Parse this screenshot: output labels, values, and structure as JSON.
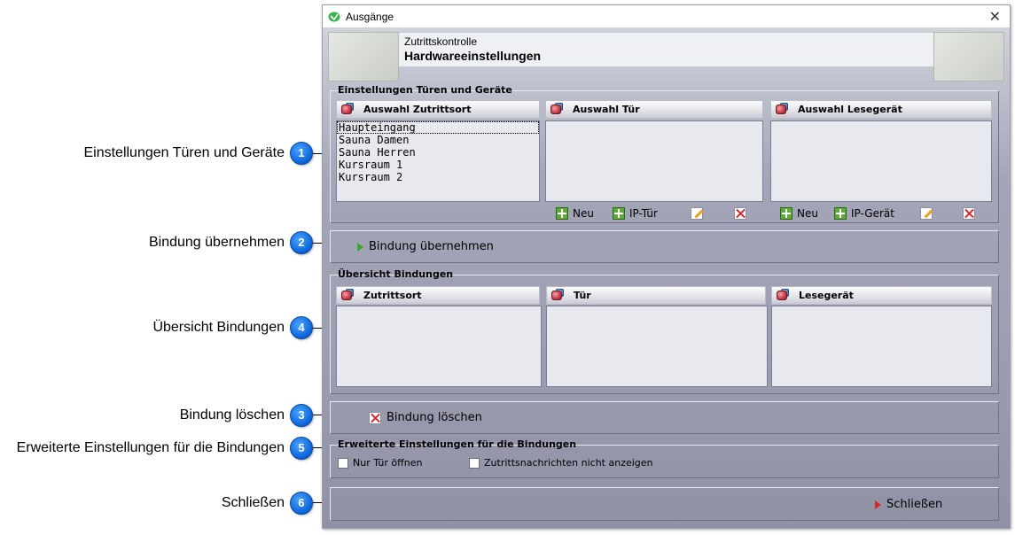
{
  "annotations": [
    {
      "num": "1",
      "label": "Einstellungen Türen und Geräte"
    },
    {
      "num": "2",
      "label": "Bindung übernehmen"
    },
    {
      "num": "4",
      "label": "Übersicht Bindungen"
    },
    {
      "num": "3",
      "label": "Bindung löschen"
    },
    {
      "num": "5",
      "label": "Erweiterte Einstellungen für die Bindungen"
    },
    {
      "num": "6",
      "label": "Schließen"
    }
  ],
  "window": {
    "title": "Ausgänge",
    "close_glyph": "✕",
    "header": {
      "subtitle": "Zutrittskontrolle",
      "title": "Hardwareeinstellungen"
    }
  },
  "settings": {
    "legend": "Einstellungen Türen und Geräte",
    "col_zutrittsort": "Auswahl Zutrittsort",
    "col_tuer": "Auswahl Tür",
    "col_lesegeraet": "Auswahl Lesegerät",
    "zutrittsorte": [
      "Haupteingang",
      "Sauna Damen",
      "Sauna Herren",
      "Kursraum 1",
      "Kursraum 2"
    ],
    "tuer_buttons": {
      "neu": "Neu",
      "ip": "IP-Tür"
    },
    "geraet_buttons": {
      "neu": "Neu",
      "ip": "IP-Gerät"
    }
  },
  "bind_button": "Bindung übernehmen",
  "overview": {
    "legend": "Übersicht Bindungen",
    "col_zutrittsort": "Zutrittsort",
    "col_tuer": "Tür",
    "col_lesegeraet": "Lesegerät"
  },
  "delete_button": "Bindung löschen",
  "extended": {
    "legend": "Erweiterte Einstellungen für die Bindungen",
    "opt1": "Nur Tür öffnen",
    "opt2": "Zutrittsnachrichten nicht anzeigen"
  },
  "close_button": "Schließen",
  "icons": {
    "bind": "play-green-icon",
    "delete": "delete-record-icon",
    "close": "play-red-icon"
  }
}
